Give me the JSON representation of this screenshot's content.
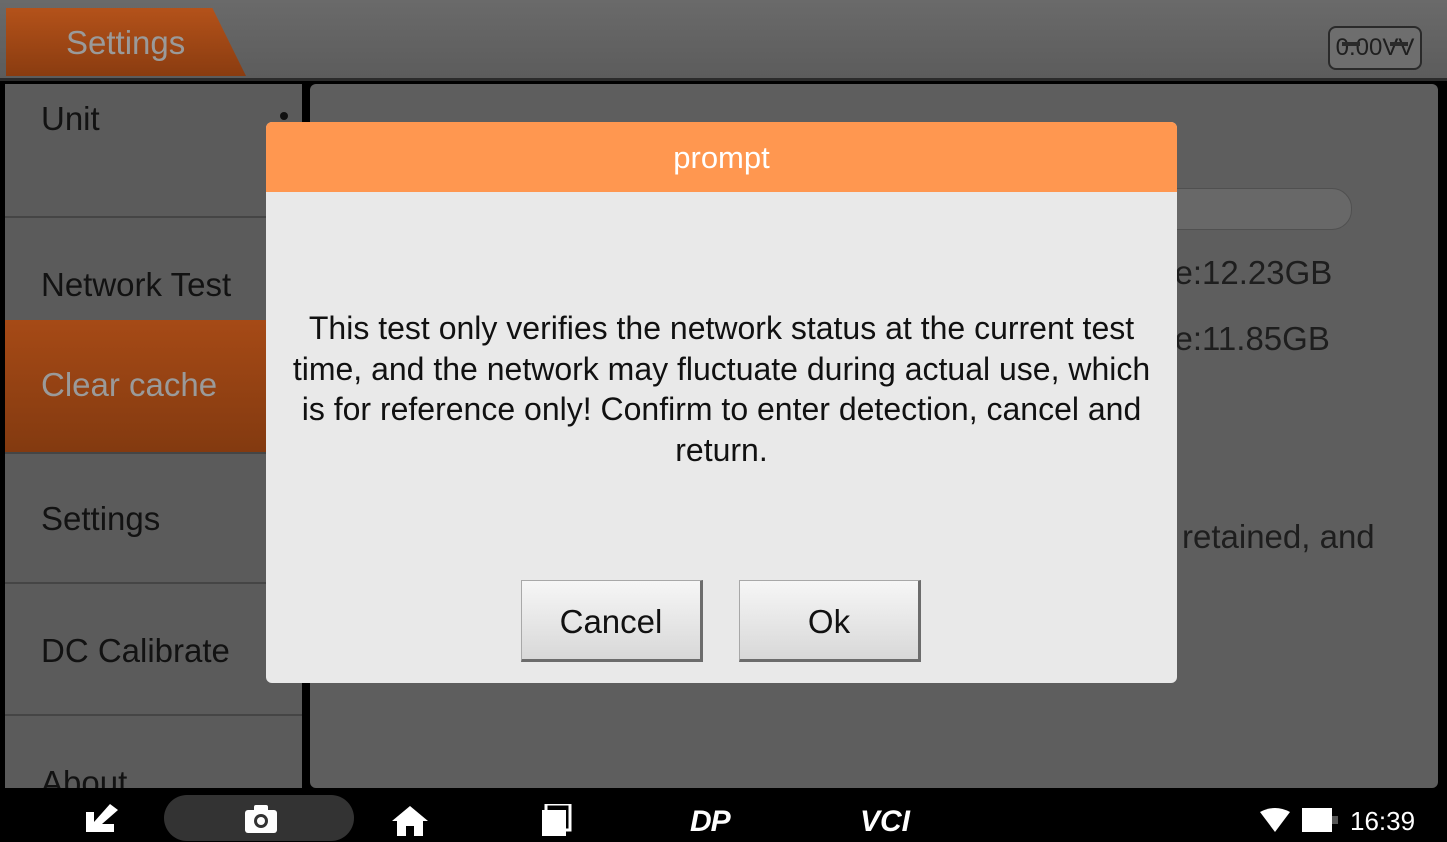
{
  "header": {
    "title": "Settings",
    "battery_voltage": "0.00VV"
  },
  "sidebar": {
    "items": [
      {
        "label": "Unit"
      },
      {
        "label": "Network Test"
      },
      {
        "label": "Clear cache"
      },
      {
        "label": "Settings"
      },
      {
        "label": "DC Calibrate"
      },
      {
        "label": "About"
      }
    ],
    "active_item": "Clear cache"
  },
  "content": {
    "space_line_1": "ce:12.23GB",
    "space_line_2": "ce:11.85GB",
    "note_fragment": "retained, and"
  },
  "dialog": {
    "title": "prompt",
    "message": "This test only verifies the network status at the current test time, and the network may fluctuate during actual use, which is for reference only! Confirm to enter detection, cancel and return.",
    "cancel_label": "Cancel",
    "ok_label": "Ok"
  },
  "navbar": {
    "dp_label": "DP",
    "vci_label": "VCI",
    "time": "16:39",
    "icons": [
      "back-icon",
      "camera-icon",
      "home-icon",
      "recent-apps-icon",
      "wifi-icon",
      "battery-icon"
    ]
  },
  "colors": {
    "accent": "#ff9750",
    "active_tab": "#a64a16",
    "dialog_bg": "#e9e9e9"
  }
}
